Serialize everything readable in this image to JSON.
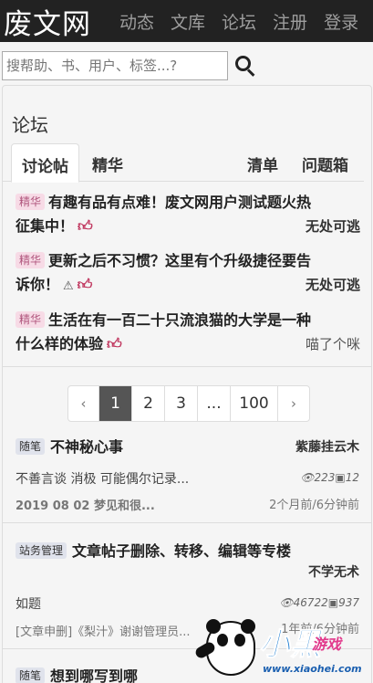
{
  "header": {
    "brand": "废文网",
    "nav": [
      "动态",
      "文库",
      "论坛",
      "注册",
      "登录"
    ]
  },
  "search": {
    "placeholder": "搜帮助、书、用户、标签...?"
  },
  "forum": {
    "title": "论坛",
    "tabs": {
      "left": [
        "讨论帖",
        "精华"
      ],
      "right": [
        "清单",
        "问题箱"
      ]
    },
    "featured": [
      {
        "tag": "精华",
        "line1": "有趣有品有点难！废文网用户测试题火热",
        "line2": "征集中！",
        "author": "无处可逃",
        "has_warning": false
      },
      {
        "tag": "精华",
        "line1": "更新之后不习惯？这里有个升级捷径要告",
        "line2": "诉你！",
        "author": "无处可逃",
        "has_warning": true
      },
      {
        "tag": "精华",
        "line1": "生活在有一百二十只流浪猫的大学是一种",
        "line2": "什么样的体验",
        "author": "喵了个咪",
        "has_warning": false
      }
    ],
    "pagination": {
      "prev": "‹",
      "pages": [
        "1",
        "2",
        "3",
        "...",
        "100"
      ],
      "next": "›",
      "current": "1"
    },
    "posts": [
      {
        "tag": "随笔",
        "title": "不神秘心事",
        "author": "紫藤挂云木",
        "summary": "不善言谈 消极 可能偶尔记录...",
        "views": "223",
        "replies": "12",
        "excerpt": "2019 08 02 梦见和很...",
        "time": "2个月前/6分钟前"
      },
      {
        "tag": "站务管理",
        "title": "文章帖子删除、转移、编辑等专楼",
        "author": "不学无术",
        "summary": "如题",
        "views": "46722",
        "replies": "937",
        "excerpt": "[文章申删]《梨汁》谢谢管理员...",
        "time": "1年前/6分钟前"
      },
      {
        "tag": "随笔",
        "title": "想到哪写到哪",
        "author": "",
        "summary": "",
        "views": "",
        "replies": "",
        "excerpt": "",
        "time": ""
      }
    ]
  },
  "watermark": {
    "main": "小黑",
    "sub": "游戏",
    "url": "www.xiaohei.com"
  },
  "icons": {
    "search": "search-icon",
    "like": "thumbs-up-icon",
    "warning": "warning-icon",
    "views": "eye-icon",
    "replies": "comment-icon"
  },
  "colors": {
    "topbar": "#222222",
    "jinghua_tag_bg": "#f7dbe6",
    "jinghua_tag_fg": "#b0567d",
    "like_icon": "#c0375f",
    "current_page_bg": "#555555"
  }
}
